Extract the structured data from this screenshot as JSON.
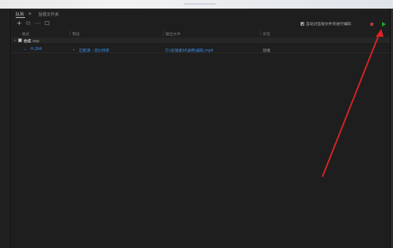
{
  "tabs": [
    {
      "label": "队列"
    },
    {
      "label": "监视文件夹"
    }
  ],
  "tab_menu_glyph": "≡",
  "toolbar": {
    "add": "+",
    "duplicate": "⧉",
    "remove": "—"
  },
  "watch_folder": {
    "checked": true,
    "label": "自动对监视文件夹进行编码"
  },
  "columns": [
    "格式",
    "预设",
    "输出文件",
    "状态"
  ],
  "group": {
    "name": "合成",
    "source": "aep"
  },
  "job": {
    "format": "H.264",
    "preset": "匹配源 - 高比特率",
    "output": "D:\\剪辑素材\\通用\\编码.mp4",
    "status": "就绪"
  },
  "colors": {
    "link": "#3d8ee8",
    "stop": "#a33b3b",
    "play": "#1fa832",
    "annotation_arrow": "#e02424"
  }
}
